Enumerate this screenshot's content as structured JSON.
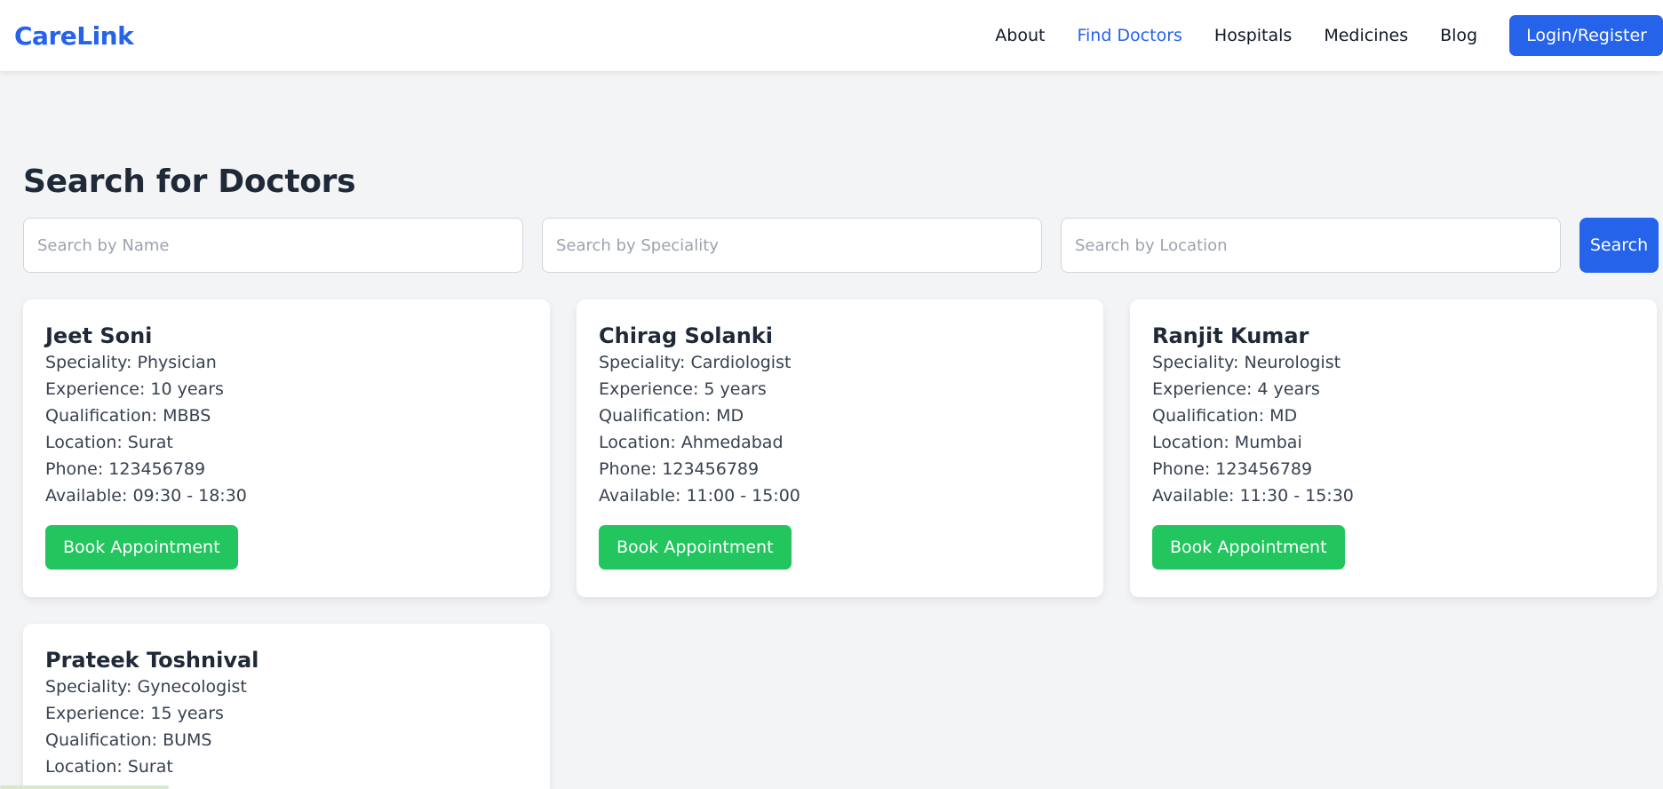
{
  "brand": {
    "name": "CareLink"
  },
  "nav": {
    "links": [
      {
        "label": "About",
        "active": false
      },
      {
        "label": "Find Doctors",
        "active": true
      },
      {
        "label": "Hospitals",
        "active": false
      },
      {
        "label": "Medicines",
        "active": false
      },
      {
        "label": "Blog",
        "active": false
      }
    ],
    "login_label": "Login/Register"
  },
  "page": {
    "title": "Search for Doctors"
  },
  "search": {
    "name_placeholder": "Search by Name",
    "speciality_placeholder": "Search by Speciality",
    "location_placeholder": "Search by Location",
    "button_label": "Search"
  },
  "doctors": [
    {
      "name": "Jeet Soni",
      "speciality": "Speciality: Physician",
      "experience": "Experience: 10 years",
      "qualification": "Qualification: MBBS",
      "location": "Location: Surat",
      "phone": "Phone: 123456789",
      "available": "Available: 09:30 - 18:30",
      "button_label": "Book Appointment"
    },
    {
      "name": "Chirag Solanki",
      "speciality": "Speciality: Cardiologist",
      "experience": "Experience: 5 years",
      "qualification": "Qualification: MD",
      "location": "Location: Ahmedabad",
      "phone": "Phone: 123456789",
      "available": "Available: 11:00 - 15:00",
      "button_label": "Book Appointment"
    },
    {
      "name": "Ranjit Kumar",
      "speciality": "Speciality: Neurologist",
      "experience": "Experience: 4 years",
      "qualification": "Qualification: MD",
      "location": "Location: Mumbai",
      "phone": "Phone: 123456789",
      "available": "Available: 11:30 - 15:30",
      "button_label": "Book Appointment"
    },
    {
      "name": "Prateek Toshnival",
      "speciality": "Speciality: Gynecologist",
      "experience": "Experience: 15 years",
      "qualification": "Qualification: BUMS",
      "location": "Location: Surat"
    }
  ],
  "colors": {
    "brand": "#2563eb",
    "book_button": "#22c55e",
    "background": "#f3f4f6"
  }
}
